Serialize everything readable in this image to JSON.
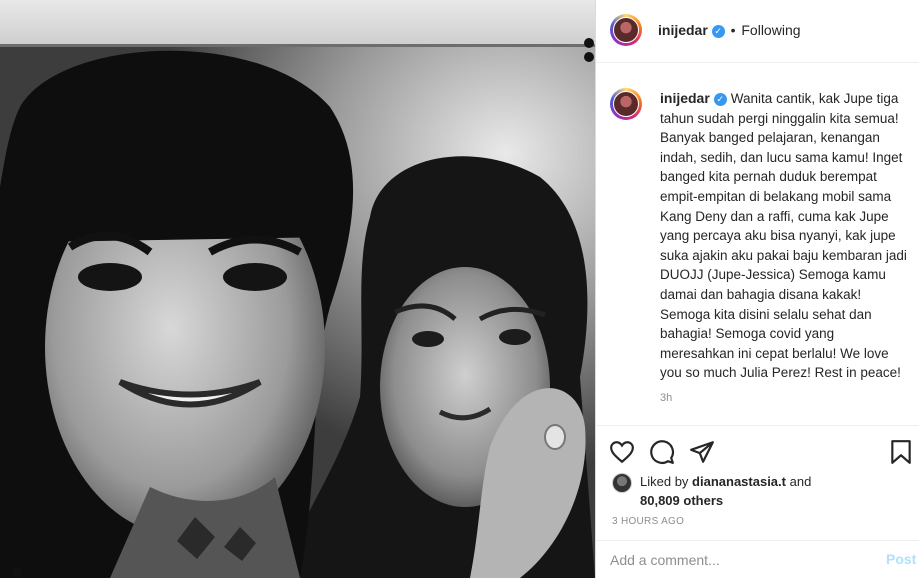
{
  "photo": {
    "alt": "Black and white selfie of two women"
  },
  "header": {
    "username": "inijedar",
    "separator": "•",
    "follow_status": "Following",
    "verified_icon": "verified-badge-icon"
  },
  "caption": {
    "username": "inijedar",
    "text": "Wanita cantik, kak Jupe tiga tahun sudah pergi ninggalin kita semua! Banyak banged pelajaran, kenangan indah, sedih, dan lucu sama kamu! Inget banged kita pernah duduk berempat empit-empitan di belakang mobil sama Kang Deny dan a raffi, cuma kak Jupe yang percaya aku bisa nyanyi, kak jupe suka ajakin aku pakai baju kembaran jadi DUOJJ (Jupe-Jessica) Semoga kamu damai dan bahagia disana kakak! Semoga kita disini selalu sehat dan bahagia! Semoga covid yang meresahkan ini cepat berlalu! We love you so much Julia Perez! Rest in peace!",
    "time": "3h"
  },
  "actions": {
    "like_icon": "heart-icon",
    "comment_icon": "comment-icon",
    "share_icon": "share-icon",
    "save_icon": "bookmark-icon"
  },
  "likes": {
    "prefix": "Liked by",
    "user": "diananastasia.t",
    "and": "and",
    "others": "80,809 others"
  },
  "posted": "3 HOURS AGO",
  "comment": {
    "placeholder": "Add a comment...",
    "post_label": "Post"
  },
  "colors": {
    "accent_blue": "#3897f0",
    "post_disabled": "#b2dffc",
    "muted": "#8e8e8e"
  }
}
